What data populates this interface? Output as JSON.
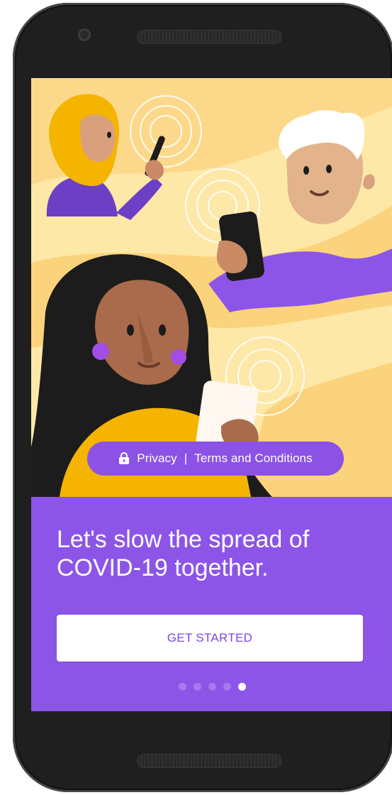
{
  "footer_links": {
    "privacy_label": "Privacy",
    "separator": "|",
    "terms_label": "Terms and Conditions",
    "icon": "lock-icon"
  },
  "onboarding": {
    "headline": "Let's slow the spread of COVID-19 together.",
    "cta_label": "GET STARTED",
    "page_indicator": {
      "total": 5,
      "current": 5
    }
  },
  "colors": {
    "accent_purple": "#8c55e8",
    "cta_text": "#8046de",
    "illustration_background": "#fde6a5",
    "device_frame": "#1f1f1f"
  }
}
